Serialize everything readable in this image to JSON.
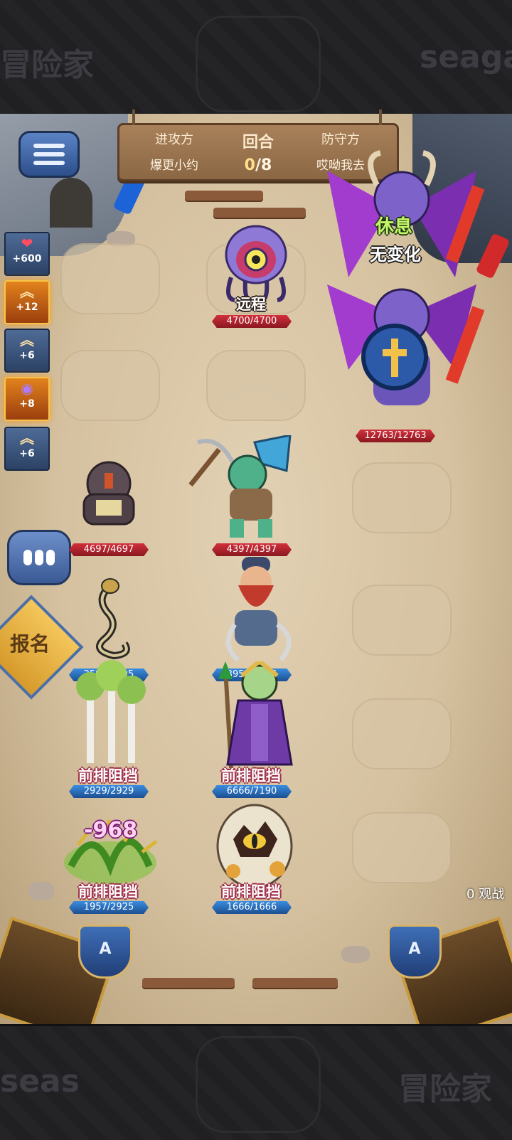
{
  "watermarks": {
    "top_left": "冒险家",
    "top_right": "seaga",
    "bottom_left": "seas",
    "bottom_right": "冒险家"
  },
  "header": {
    "attacker_label": "进攻方",
    "attacker_name": "爆更小约",
    "round_label": "回合",
    "round_current": "0",
    "round_total": "/8",
    "defender_label": "防守方",
    "defender_name": "哎呦我去"
  },
  "buffs": [
    {
      "icon": "heart-icon",
      "glyph": "❤",
      "value": "+600",
      "lit": false
    },
    {
      "icon": "chevron-up-icon",
      "glyph": "︽",
      "value": "+12",
      "lit": true
    },
    {
      "icon": "chevron-up-icon",
      "glyph": "︽",
      "value": "+6",
      "lit": false
    },
    {
      "icon": "magic-orb-icon",
      "glyph": "◉",
      "value": "+8",
      "lit": true
    },
    {
      "icon": "chevron-up-icon",
      "glyph": "︽",
      "value": "+6",
      "lit": false
    }
  ],
  "signup_label": "报名",
  "spectators": "0 观战",
  "enemy_units": [
    {
      "name": "eye-monster",
      "tag": "远程",
      "hp": "4700/4700"
    },
    {
      "name": "demon-boss",
      "status_top": "休息",
      "status_bottom": "无变化",
      "hp": "12763/12763"
    },
    {
      "name": "rock-golem",
      "hp": "4697/4697"
    },
    {
      "name": "goblin-miner",
      "hp": "4397/4397"
    }
  ],
  "ally_units": [
    {
      "name": "cobra",
      "hp": "2590/2595"
    },
    {
      "name": "dwarf-warrior",
      "hp": "3956/3956"
    },
    {
      "name": "birch-trees",
      "tag": "前排阻挡",
      "hp": "2929/2929"
    },
    {
      "name": "skeleton-mage",
      "tag": "前排阻挡",
      "hp": "6666/7190"
    },
    {
      "name": "thorn-bush",
      "tag": "前排阻挡",
      "hp": "1957/2925",
      "damage": "-968"
    },
    {
      "name": "dragon-egg",
      "tag": "前排阻挡",
      "hp": "1666/1666"
    }
  ],
  "colors": {
    "enemy_hp": "#d3303b",
    "ally_hp": "#3b8de0",
    "board": "#d5c19f",
    "status_green": "#c6f56a",
    "damage_pink": "#ffd1f3"
  }
}
